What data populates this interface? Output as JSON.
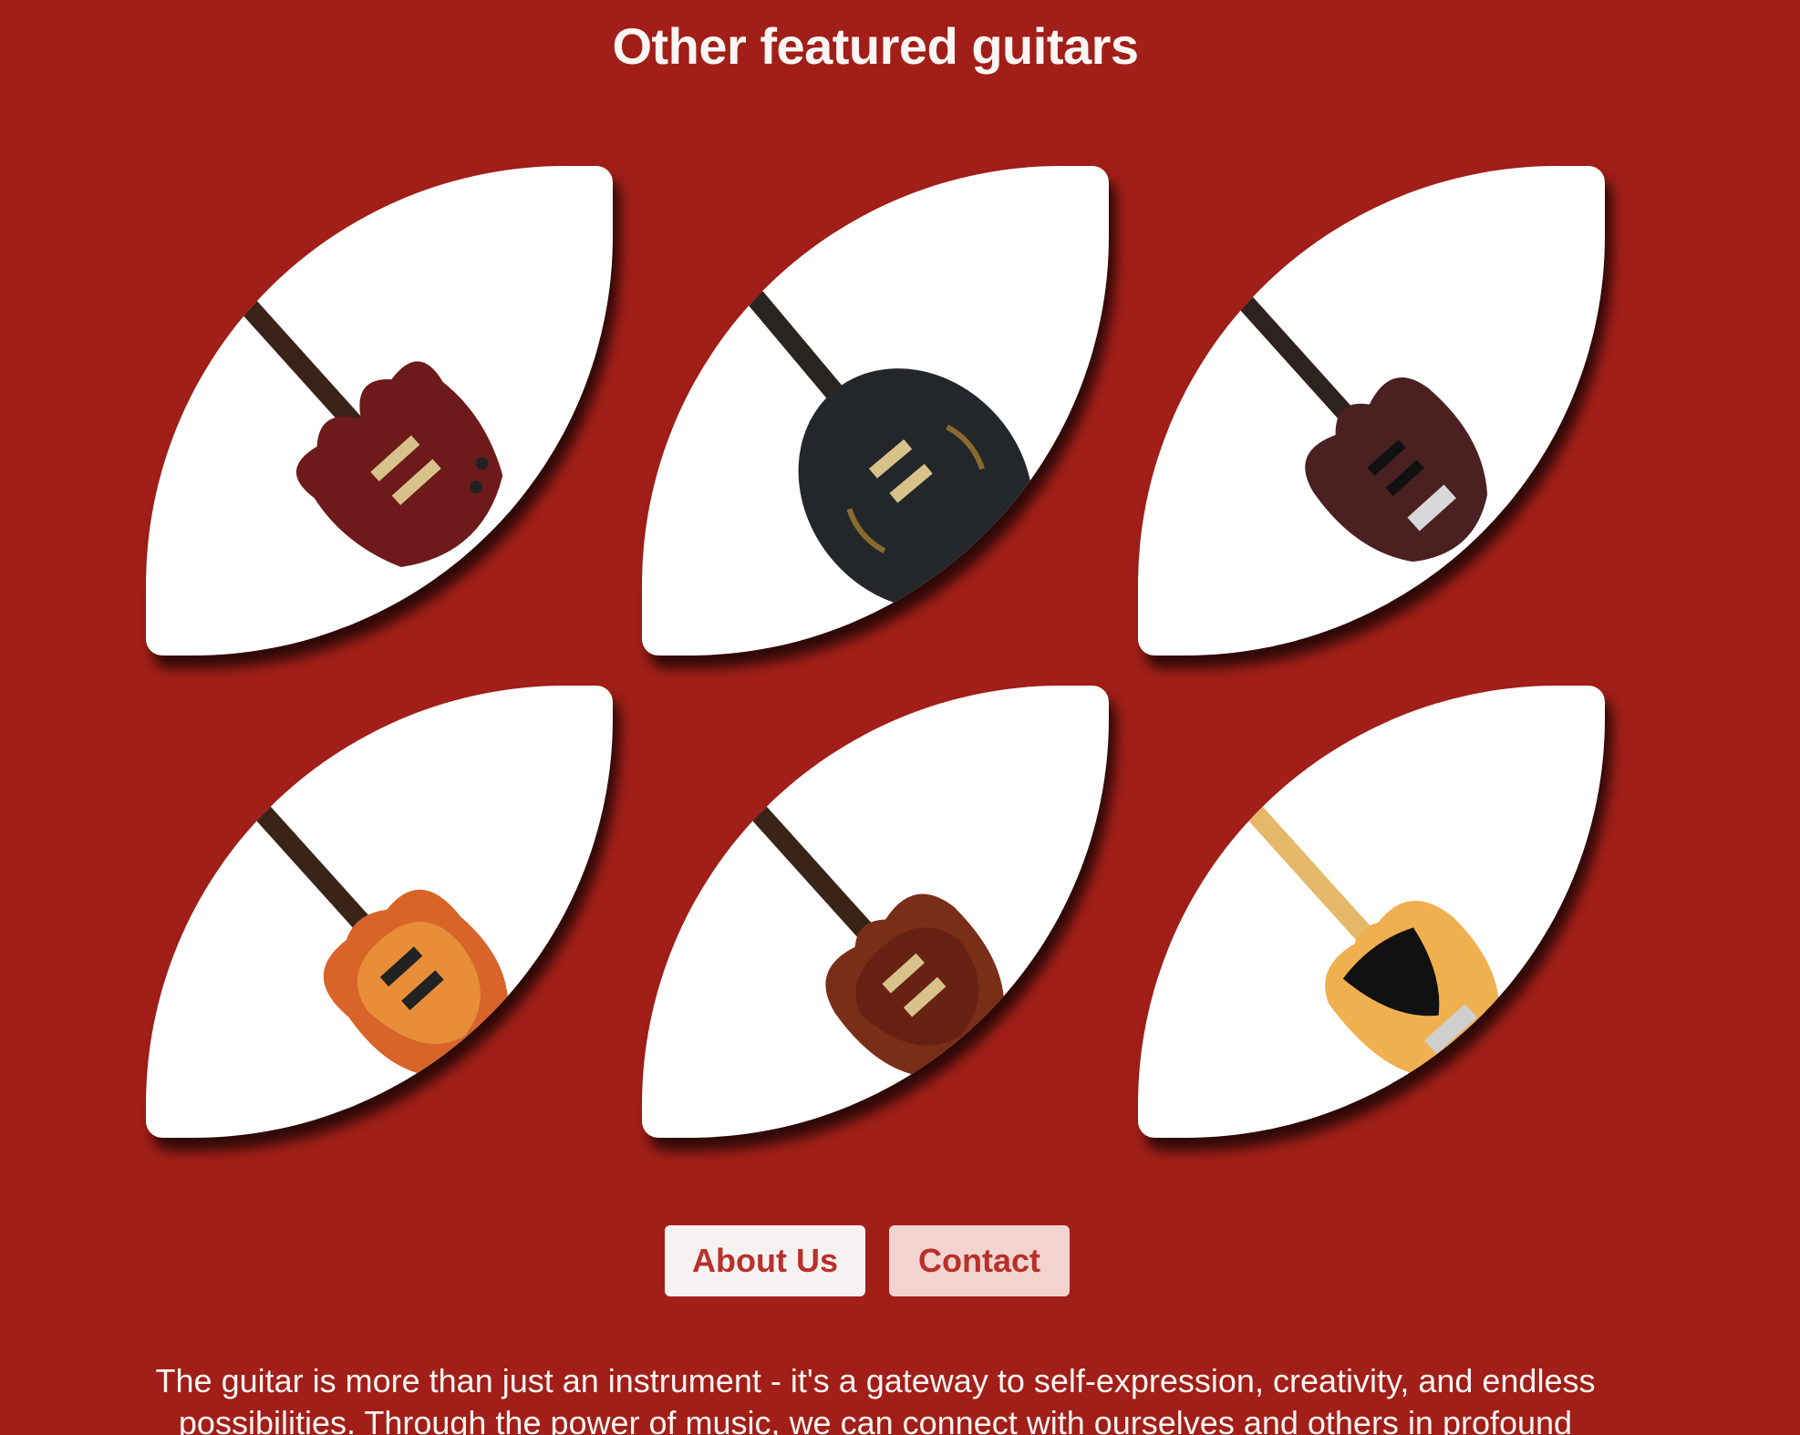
{
  "section": {
    "title": "Other featured guitars"
  },
  "guitars": [
    {
      "name": "sg-style-guitar",
      "body_color": "#6e1a1a",
      "neck_color": "#3b2218"
    },
    {
      "name": "semi-hollow-guitar",
      "body_color": "#24272a",
      "neck_color": "#2a2420"
    },
    {
      "name": "superstrat-guitar",
      "body_color": "#4a2020",
      "neck_color": "#2e2220"
    },
    {
      "name": "les-paul-style-guitar",
      "body_color": "#d8642a",
      "neck_color": "#3a2418"
    },
    {
      "name": "prs-style-guitar",
      "body_color": "#7a2e18",
      "neck_color": "#3a2418"
    },
    {
      "name": "telecaster-style-guitar",
      "body_color": "#f0b050",
      "neck_color": "#e6b86a"
    }
  ],
  "buttons": {
    "about_label": "About Us",
    "contact_label": "Contact"
  },
  "blurb": {
    "text": "The guitar is more than just an instrument - it's a gateway to self-expression, creativity, and endless possibilities. Through the power of music, we can connect with ourselves and others in profound"
  },
  "colors": {
    "background": "#a11f18",
    "card": "#ffffff",
    "button_text": "#b8312a",
    "about_bg": "#f6f2f1",
    "contact_bg": "#f3d3d0"
  }
}
